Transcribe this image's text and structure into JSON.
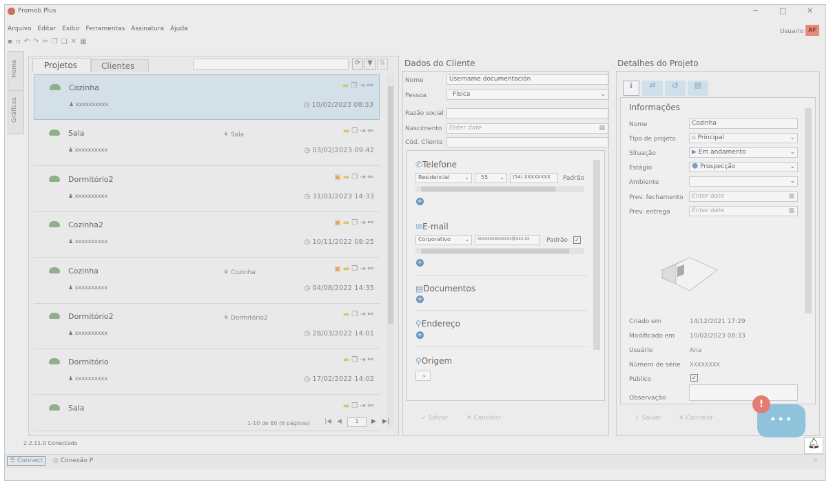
{
  "window": {
    "title": "Promob Plus",
    "minimize": "−",
    "maximize": "□",
    "close": "✕",
    "user_label": "Usuario",
    "user_badge": "AF"
  },
  "menu": [
    "Arquivo",
    "Editar",
    "Exibir",
    "Ferramentas",
    "Assinatura",
    "Ajuda"
  ],
  "side_tabs": {
    "home": "Home",
    "graphics": "Gráficos"
  },
  "projects_panel": {
    "tabs": [
      "Projetos",
      "Clientes"
    ],
    "search_placeholder": "",
    "pagination": "1-10 de 60 (6 páginas)",
    "page": "1",
    "rows": [
      {
        "name": "Cozinha",
        "user": "xxxxxxxxxx",
        "ambiente": "",
        "date": "10/02/2023 08:33",
        "selected": true
      },
      {
        "name": "Sala",
        "user": "xxxxxxxxxx",
        "ambiente": "Sala",
        "date": "03/02/2023 09:42"
      },
      {
        "name": "Dormitório2",
        "user": "xxxxxxxxxx",
        "ambiente": "",
        "date": "31/01/2023 14:33"
      },
      {
        "name": "Cozinha2",
        "user": "xxxxxxxxxx",
        "ambiente": "",
        "date": "10/11/2022 08:25"
      },
      {
        "name": "Cozinha",
        "user": "xxxxxxxxxx",
        "ambiente": "Cozinha",
        "date": "04/08/2022 14:35"
      },
      {
        "name": "Dormitório2",
        "user": "xxxxxxxxxx",
        "ambiente": "Dormitório2",
        "date": "28/03/2022 14:01"
      },
      {
        "name": "Dormitório",
        "user": "xxxxxxxxxx",
        "ambiente": "",
        "date": "17/02/2022 14:02"
      },
      {
        "name": "Sala",
        "user": "",
        "ambiente": "",
        "date": ""
      }
    ]
  },
  "client": {
    "title": "Dados do Cliente",
    "nome_label": "Nome",
    "nome_value": "Username documentación",
    "pessoa_label": "Pessoa",
    "pessoa_value": "Física",
    "razao_label": "Razão social",
    "nasc_label": "Nascimento",
    "nasc_placeholder": "Enter date",
    "cod_label": "Cód. Cliente",
    "telefone": {
      "title": "Telefone",
      "type": "Residencial",
      "ddi": "55",
      "number": "(54) XXXXXXXX",
      "padrao": "Padrão"
    },
    "email": {
      "title": "E-mail",
      "type": "Corporativo",
      "value": "xxxxxxxxxxxxxx@xxx.xx",
      "padrao": "Padrão"
    },
    "documentos": "Documentos",
    "endereco": "Endereço",
    "origem": "Origem",
    "save": "Salvar",
    "cancel": "Cancelar"
  },
  "project": {
    "title": "Detalhes do Projeto",
    "section": "Informações",
    "nome_label": "Nome",
    "nome_value": "Cozinha",
    "tipo_label": "Tipo de projeto",
    "tipo_value": "Principal",
    "situacao_label": "Situação",
    "situacao_value": "Em andamento",
    "estagio_label": "Estágio",
    "estagio_value": "Prospecção",
    "ambiente_label": "Ambiente",
    "prev_fech_label": "Prev. fechamento",
    "prev_fech_ph": "Enter date",
    "prev_ent_label": "Prev. entrega",
    "prev_ent_ph": "Enter date",
    "criado_label": "Criado em",
    "criado_value": "14/12/2021 17:29",
    "modificado_label": "Modificado em",
    "modificado_value": "10/02/2023 08:33",
    "usuario_label": "Usuário",
    "usuario_value": "Ana",
    "serie_label": "Número de série",
    "serie_value": "XXXXXXXX",
    "publico_label": "Público",
    "obs_label": "Observação",
    "save": "Salvar",
    "cancel": "Cancelar"
  },
  "status": {
    "version": "2.2.11.0 Conectado",
    "connect": "Connect",
    "conexao": "Conexão P"
  },
  "chat": {
    "alert": "!",
    "dots": "•••"
  },
  "colors": {
    "accent": "#6b94b7",
    "badge": "#e58b7a",
    "chat": "#8fc3dc",
    "alert": "#e57b73"
  }
}
